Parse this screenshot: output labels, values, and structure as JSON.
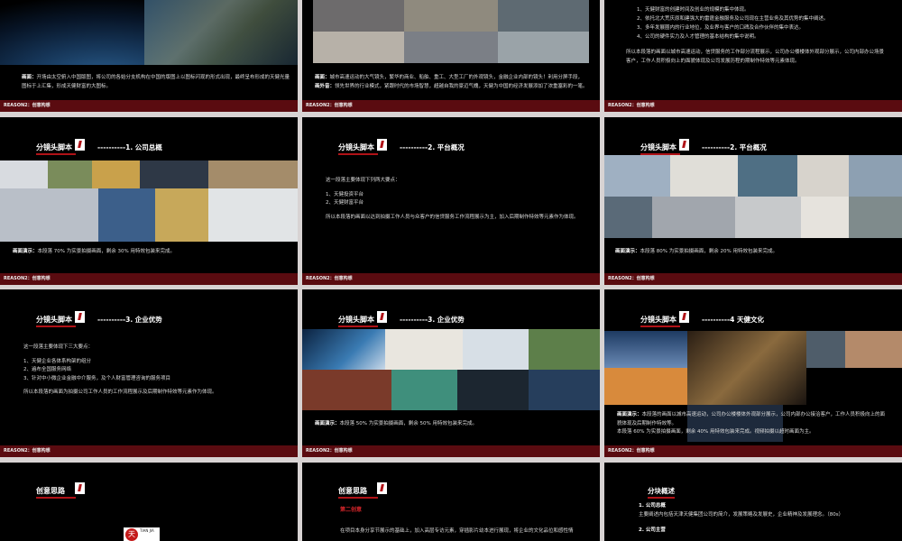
{
  "footer_label": "REASON2：创意构想",
  "header_script": "分镜头脚本",
  "header_idea": "创意思路",
  "row1": {
    "s1": {
      "label": "画面：",
      "text1": "开场由太空俯入中国版图，将公司的各始分支机构在中国的版图上以图标闪现的形式出现，最终呈布形成的天健光量",
      "text2": "图标于上汇集，形成天健财富的大图标。"
    },
    "s2": {
      "label1": "画面：",
      "text1": "城市高速运动的大气镜头，繁华的商业、船舶、重工、大型工厂的外观镜头，金融企业内部的镜头！利用分屏手段，",
      "label2": "画外音：",
      "text2": "领先世界的行业模式，紧跟时代的市场智慧，超越自我的豪迈气魄，天健为中国的经济发展添加了浓重塞彩的一笔。"
    },
    "s3": {
      "items": [
        "1、天健财富的创建时间及创业的规模的集中体现。",
        "2、依托北大荒庆原和建强大的雷霆金融服务及公司现在主营业务及其优势的集中阐述。",
        "3、多年发展圈内的行业地位，及业界与客户的口碑及合作伙伴的集中表达。",
        "4、公司的硬件实力及人才管理的基本结构的集中说明。"
      ],
      "para1": "所以本段落的画面以城市高速运动，信贷服务的工作部分流程展示，公司办公楼楼体外观部分展示，公司内部办公场景",
      "para2": "客户，工作人员积极向上的面貌体现及公司发展历程的期制作特效等元素体现。"
    }
  },
  "row2": {
    "s1": {
      "section": "----------1. 公司总概",
      "cap_label": "画面演示：",
      "cap": "本段落 70% 为实景拍摄画面，剩余 30% 用特效包装来完成。"
    },
    "s2": {
      "section": "----------2. 平台概况",
      "lines": [
        "这一段落主要体现下列两大要点：",
        "",
        "1、天健投资平台",
        "2、天健财富平台",
        "",
        "所以本段落的画面以达到拍摄工作人员与众客户的信贷服务工作流程展示为主，加入后期制作特效等元素作为体现。"
      ]
    },
    "s3": {
      "section": "----------2. 平台概况",
      "cap_label": "画面演示：",
      "cap": "本段落 80% 为实景拍摄画面，剩余 20% 用特效包装来完成。"
    }
  },
  "row3": {
    "s1": {
      "section": "----------3. 企业优势",
      "lines": [
        "这一段落主要体现下三大要点：",
        "",
        "1、天健企业各体系构架的组分",
        "2、遍布全国服务网络",
        "3、针对中小微企业金融中介服务，及个人财富管理咨询的服务项目",
        "",
        "所以本段落的画面为拍摄公司工作人员的工作流程展示及后期制作特效等元素作为体现。"
      ]
    },
    "s2": {
      "section": "----------3. 企业优势",
      "cap_label": "画面演示：",
      "cap": "本段落 50% 为实景拍摄画面，剩余 50% 用特效包装来完成。"
    },
    "s3": {
      "section": "----------4 天健文化",
      "cap_label": "画面演示：",
      "cap1": "本段落的画面以城市高速运动，公司办公楼楼体外观部分展示，公司内部办公接洽客户，工作人员积极向上的面",
      "cap2": "貌体现及后期制作特效等。",
      "cap3": "本段落 60% 为实景拍摄画面，剩余 40% 用特效包装来完成。视频拍摄以超时画面为主。"
    }
  },
  "row4": {
    "s1": {
      "logo_text": "天",
      "logo_small": "TIAN JIA"
    },
    "s2": {
      "red_title": "第二创意",
      "line": "在项目本身分享节展示的基础上，加入高层专访元素，穿插影片幼本进行展现，将企业的文化品位和感性情"
    },
    "s3": {
      "title": "分块概述",
      "h1": "1. 公司总概",
      "t1": "主要阐述内包括天津天健集团公司的简介，发展策略及发展史，企业精神及发展理念。（80s）",
      "h2": "2. 公司主营"
    }
  },
  "colors": {
    "accent_red": "#b01217",
    "footer_red": "#5a0b10",
    "slide_bg": "#000000"
  }
}
